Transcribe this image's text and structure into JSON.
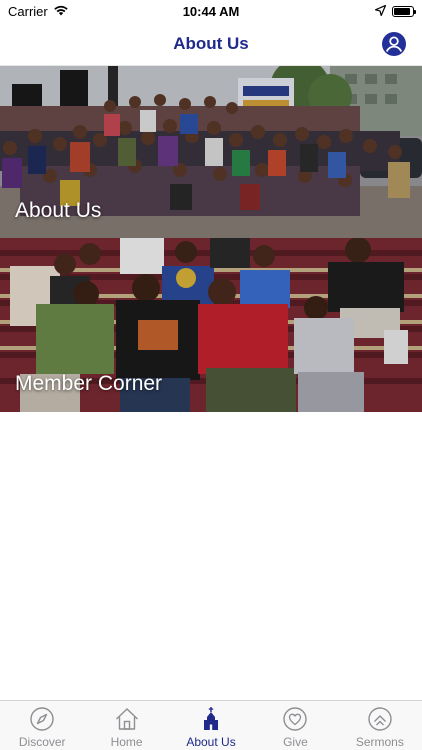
{
  "status_bar": {
    "carrier": "Carrier",
    "time": "10:44 AM",
    "battery_level": 0.9
  },
  "nav": {
    "title": "About Us",
    "profile_icon": "person-circle-icon"
  },
  "tiles": [
    {
      "label": "About Us",
      "image": "group-photo-outdoor-crowd"
    },
    {
      "label": "Member Corner",
      "image": "group-photo-men-on-bleachers"
    }
  ],
  "tab_bar": {
    "active_index": 2,
    "tabs": [
      {
        "label": "Discover",
        "icon": "compass-icon"
      },
      {
        "label": "Home",
        "icon": "house-icon"
      },
      {
        "label": "About Us",
        "icon": "church-icon"
      },
      {
        "label": "Give",
        "icon": "heart-icon"
      },
      {
        "label": "Sermons",
        "icon": "sermons-icon"
      }
    ]
  },
  "colors": {
    "accent": "#1f2a8a",
    "tab_inactive": "#8e8e93",
    "tab_bar_bg": "#f8f8f8"
  }
}
